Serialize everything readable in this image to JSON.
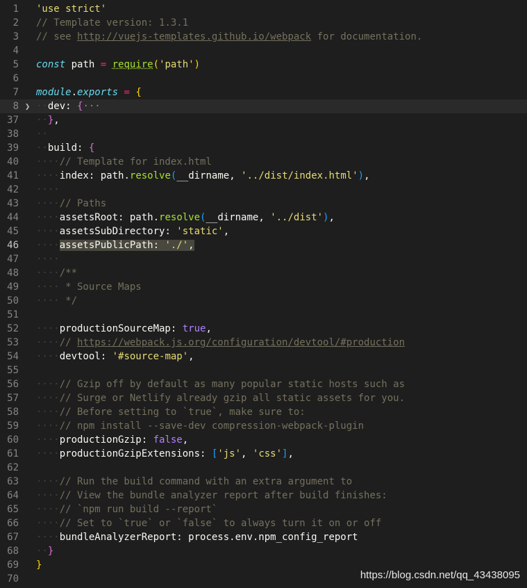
{
  "watermark": "https://blog.csdn.net/qq_43438095",
  "lines": [
    {
      "n": "1",
      "tokens": [
        {
          "t": "'use strict'",
          "c": "t-strY"
        }
      ]
    },
    {
      "n": "2",
      "tokens": [
        {
          "t": "// Template version: 1.3.1",
          "c": "t-cg"
        }
      ]
    },
    {
      "n": "3",
      "tokens": [
        {
          "t": "// see ",
          "c": "t-cg"
        },
        {
          "t": "http://vuejs-templates.github.io/webpack",
          "c": "t-url"
        },
        {
          "t": " for documentation.",
          "c": "t-cg"
        }
      ]
    },
    {
      "n": "4",
      "tokens": []
    },
    {
      "n": "5",
      "tokens": [
        {
          "t": "const",
          "c": "t-kw"
        },
        {
          "t": " path ",
          "c": "t-plain"
        },
        {
          "t": "=",
          "c": "t-op"
        },
        {
          "t": " ",
          "c": "t-plain"
        },
        {
          "t": "require",
          "c": "t-fnU"
        },
        {
          "t": "(",
          "c": "t-br1"
        },
        {
          "t": "'path'",
          "c": "t-strY"
        },
        {
          "t": ")",
          "c": "t-br1"
        }
      ]
    },
    {
      "n": "6",
      "tokens": []
    },
    {
      "n": "7",
      "tokens": [
        {
          "t": "module",
          "c": "t-kw"
        },
        {
          "t": ".",
          "c": "t-plain"
        },
        {
          "t": "exports",
          "c": "t-kw"
        },
        {
          "t": " ",
          "c": "t-plain"
        },
        {
          "t": "=",
          "c": "t-op"
        },
        {
          "t": " ",
          "c": "t-plain"
        },
        {
          "t": "{",
          "c": "t-br1"
        }
      ]
    },
    {
      "n": "8",
      "fold": ">",
      "current": true,
      "tokens": [
        {
          "t": "··",
          "c": "guide"
        },
        {
          "t": "dev",
          "c": "t-plain"
        },
        {
          "t": ": ",
          "c": "t-plain"
        },
        {
          "t": "{",
          "c": "t-br2"
        },
        {
          "t": "···",
          "c": "t-dim"
        }
      ]
    },
    {
      "n": "37",
      "tokens": [
        {
          "t": "··",
          "c": "guide"
        },
        {
          "t": "}",
          "c": "t-br2"
        },
        {
          "t": ",",
          "c": "t-plain"
        }
      ]
    },
    {
      "n": "38",
      "tokens": [
        {
          "t": "··",
          "c": "guide"
        }
      ]
    },
    {
      "n": "39",
      "tokens": [
        {
          "t": "··",
          "c": "guide"
        },
        {
          "t": "build",
          "c": "t-plain"
        },
        {
          "t": ": ",
          "c": "t-plain"
        },
        {
          "t": "{",
          "c": "t-br2"
        }
      ]
    },
    {
      "n": "40",
      "tokens": [
        {
          "t": "····",
          "c": "guide"
        },
        {
          "t": "// Template for index.html",
          "c": "t-cg"
        }
      ]
    },
    {
      "n": "41",
      "tokens": [
        {
          "t": "····",
          "c": "guide"
        },
        {
          "t": "index",
          "c": "t-plain"
        },
        {
          "t": ": path.",
          "c": "t-plain"
        },
        {
          "t": "resolve",
          "c": "t-fn"
        },
        {
          "t": "(",
          "c": "t-br3"
        },
        {
          "t": "__dirname, ",
          "c": "t-plain"
        },
        {
          "t": "'../dist/index.html'",
          "c": "t-strY"
        },
        {
          "t": ")",
          "c": "t-br3"
        },
        {
          "t": ",",
          "c": "t-plain"
        }
      ]
    },
    {
      "n": "42",
      "tokens": [
        {
          "t": "····",
          "c": "guide"
        }
      ]
    },
    {
      "n": "43",
      "tokens": [
        {
          "t": "····",
          "c": "guide"
        },
        {
          "t": "// Paths",
          "c": "t-cg"
        }
      ]
    },
    {
      "n": "44",
      "tokens": [
        {
          "t": "····",
          "c": "guide"
        },
        {
          "t": "assetsRoot",
          "c": "t-plain"
        },
        {
          "t": ": path.",
          "c": "t-plain"
        },
        {
          "t": "resolve",
          "c": "t-fn"
        },
        {
          "t": "(",
          "c": "t-br3"
        },
        {
          "t": "__dirname, ",
          "c": "t-plain"
        },
        {
          "t": "'../dist'",
          "c": "t-strY"
        },
        {
          "t": ")",
          "c": "t-br3"
        },
        {
          "t": ",",
          "c": "t-plain"
        }
      ]
    },
    {
      "n": "45",
      "tokens": [
        {
          "t": "····",
          "c": "guide"
        },
        {
          "t": "assetsSubDirectory",
          "c": "t-plain"
        },
        {
          "t": ": ",
          "c": "t-plain"
        },
        {
          "t": "'static'",
          "c": "t-strY"
        },
        {
          "t": ",",
          "c": "t-plain"
        }
      ]
    },
    {
      "n": "46",
      "active": true,
      "tokens": [
        {
          "t": "····",
          "c": "guide"
        },
        {
          "t": "assetsPublicPath: ",
          "c": "t-plain sel"
        },
        {
          "t": "'./'",
          "c": "t-strY sel"
        },
        {
          "t": ",",
          "c": "t-plain sel"
        }
      ]
    },
    {
      "n": "47",
      "tokens": [
        {
          "t": "····",
          "c": "guide"
        }
      ]
    },
    {
      "n": "48",
      "tokens": [
        {
          "t": "····",
          "c": "guide"
        },
        {
          "t": "/**",
          "c": "t-cg"
        }
      ]
    },
    {
      "n": "49",
      "tokens": [
        {
          "t": "····",
          "c": "guide"
        },
        {
          "t": " * Source Maps",
          "c": "t-cg"
        }
      ]
    },
    {
      "n": "50",
      "tokens": [
        {
          "t": "····",
          "c": "guide"
        },
        {
          "t": " */",
          "c": "t-cg"
        }
      ]
    },
    {
      "n": "51",
      "tokens": []
    },
    {
      "n": "52",
      "tokens": [
        {
          "t": "····",
          "c": "guide"
        },
        {
          "t": "productionSourceMap",
          "c": "t-plain"
        },
        {
          "t": ": ",
          "c": "t-plain"
        },
        {
          "t": "true",
          "c": "t-num"
        },
        {
          "t": ",",
          "c": "t-plain"
        }
      ]
    },
    {
      "n": "53",
      "tokens": [
        {
          "t": "····",
          "c": "guide"
        },
        {
          "t": "// ",
          "c": "t-cg"
        },
        {
          "t": "https://webpack.js.org/configuration/devtool/#production",
          "c": "t-url"
        }
      ]
    },
    {
      "n": "54",
      "tokens": [
        {
          "t": "····",
          "c": "guide"
        },
        {
          "t": "devtool",
          "c": "t-plain"
        },
        {
          "t": ": ",
          "c": "t-plain"
        },
        {
          "t": "'#source-map'",
          "c": "t-strY"
        },
        {
          "t": ",",
          "c": "t-plain"
        }
      ]
    },
    {
      "n": "55",
      "tokens": []
    },
    {
      "n": "56",
      "tokens": [
        {
          "t": "····",
          "c": "guide"
        },
        {
          "t": "// Gzip off by default as many popular static hosts such as",
          "c": "t-cg"
        }
      ]
    },
    {
      "n": "57",
      "tokens": [
        {
          "t": "····",
          "c": "guide"
        },
        {
          "t": "// Surge or Netlify already gzip all static assets for you.",
          "c": "t-cg"
        }
      ]
    },
    {
      "n": "58",
      "tokens": [
        {
          "t": "····",
          "c": "guide"
        },
        {
          "t": "// Before setting to `true`, make sure to:",
          "c": "t-cg"
        }
      ]
    },
    {
      "n": "59",
      "tokens": [
        {
          "t": "····",
          "c": "guide"
        },
        {
          "t": "// npm install --save-dev compression-webpack-plugin",
          "c": "t-cg"
        }
      ]
    },
    {
      "n": "60",
      "tokens": [
        {
          "t": "····",
          "c": "guide"
        },
        {
          "t": "productionGzip",
          "c": "t-plain"
        },
        {
          "t": ": ",
          "c": "t-plain"
        },
        {
          "t": "false",
          "c": "t-num"
        },
        {
          "t": ",",
          "c": "t-plain"
        }
      ]
    },
    {
      "n": "61",
      "tokens": [
        {
          "t": "····",
          "c": "guide"
        },
        {
          "t": "productionGzipExtensions",
          "c": "t-plain"
        },
        {
          "t": ": ",
          "c": "t-plain"
        },
        {
          "t": "[",
          "c": "t-br3"
        },
        {
          "t": "'js'",
          "c": "t-strY"
        },
        {
          "t": ", ",
          "c": "t-plain"
        },
        {
          "t": "'css'",
          "c": "t-strY"
        },
        {
          "t": "]",
          "c": "t-br3"
        },
        {
          "t": ",",
          "c": "t-plain"
        }
      ]
    },
    {
      "n": "62",
      "tokens": []
    },
    {
      "n": "63",
      "tokens": [
        {
          "t": "····",
          "c": "guide"
        },
        {
          "t": "// Run the build command with an extra argument to",
          "c": "t-cg"
        }
      ]
    },
    {
      "n": "64",
      "tokens": [
        {
          "t": "····",
          "c": "guide"
        },
        {
          "t": "// View the bundle analyzer report after build finishes:",
          "c": "t-cg"
        }
      ]
    },
    {
      "n": "65",
      "tokens": [
        {
          "t": "····",
          "c": "guide"
        },
        {
          "t": "// `npm run build --report`",
          "c": "t-cg"
        }
      ]
    },
    {
      "n": "66",
      "tokens": [
        {
          "t": "····",
          "c": "guide"
        },
        {
          "t": "// Set to `true` or `false` to always turn it on or off",
          "c": "t-cg"
        }
      ]
    },
    {
      "n": "67",
      "tokens": [
        {
          "t": "····",
          "c": "guide"
        },
        {
          "t": "bundleAnalyzerReport",
          "c": "t-plain"
        },
        {
          "t": ": process.env.npm_config_report",
          "c": "t-plain"
        }
      ]
    },
    {
      "n": "68",
      "tokens": [
        {
          "t": "··",
          "c": "guide"
        },
        {
          "t": "}",
          "c": "t-br2"
        }
      ]
    },
    {
      "n": "69",
      "tokens": [
        {
          "t": "}",
          "c": "t-br1"
        }
      ]
    },
    {
      "n": "70",
      "tokens": []
    }
  ]
}
